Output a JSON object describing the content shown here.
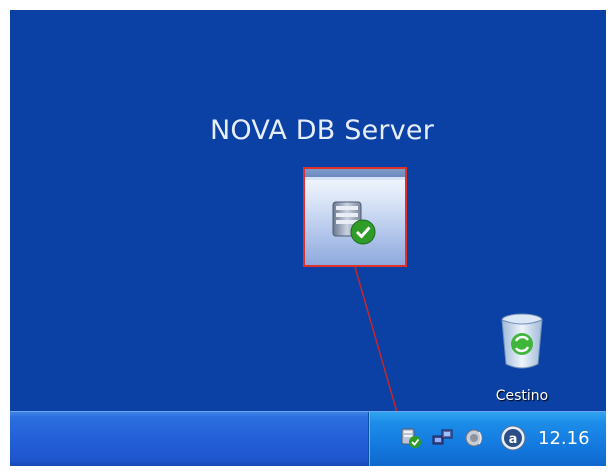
{
  "callout": {
    "title": "NOVA DB Server"
  },
  "desktop_icons": [
    {
      "label": "Cestino",
      "icon": "recycle-bin-icon"
    }
  ],
  "tray": {
    "icons": [
      "nova-db-server-icon",
      "network-icon",
      "speaker-icon",
      "agent-a-icon"
    ],
    "clock": "12.16"
  },
  "colors": {
    "desktop": "#0b40a4",
    "highlight": "#e0302a",
    "taskbar": "#245fd8",
    "tray": "#147ae0"
  }
}
